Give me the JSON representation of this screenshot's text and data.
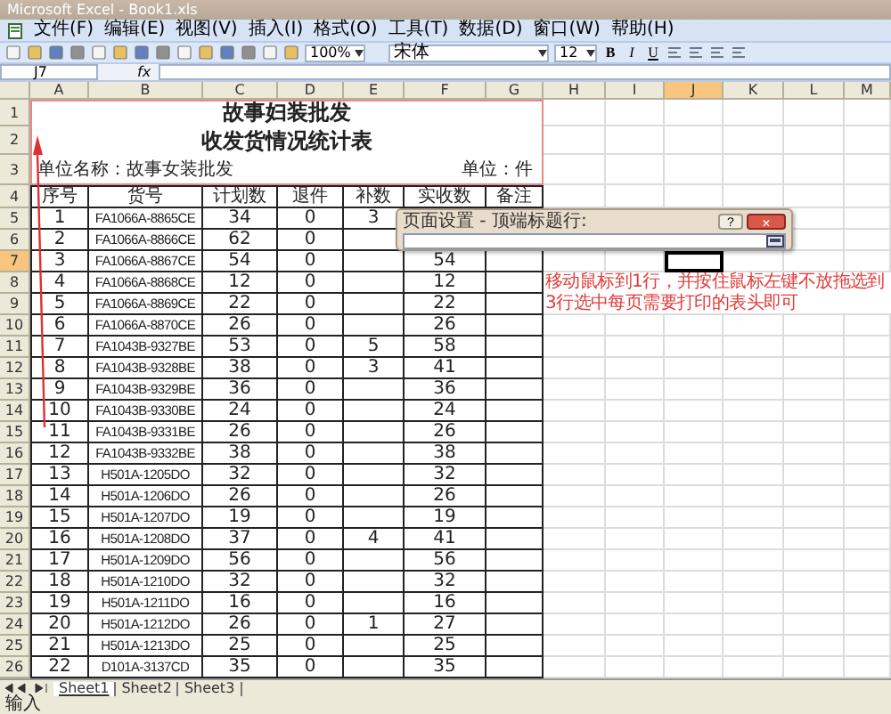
{
  "window": {
    "title": "Microsoft Excel - Book1.xls"
  },
  "menu": [
    "文件(F)",
    "编辑(E)",
    "视图(V)",
    "插入(I)",
    "格式(O)",
    "工具(T)",
    "数据(D)",
    "窗口(W)",
    "帮助(H)"
  ],
  "toolbar": {
    "zoom": "100%",
    "font": "宋体",
    "size": "12",
    "format_buttons": [
      "B",
      "I",
      "U"
    ]
  },
  "formula_bar": {
    "name_box": "J7",
    "fx": "fx"
  },
  "columns": [
    {
      "label": "A",
      "selected": false
    },
    {
      "label": "B",
      "selected": false
    },
    {
      "label": "C",
      "selected": false
    },
    {
      "label": "D",
      "selected": false
    },
    {
      "label": "E",
      "selected": false
    },
    {
      "label": "F",
      "selected": false
    },
    {
      "label": "G",
      "selected": false
    },
    {
      "label": "H",
      "selected": false
    },
    {
      "label": "I",
      "selected": false
    },
    {
      "label": "J",
      "selected": true
    },
    {
      "label": "K",
      "selected": false
    },
    {
      "label": "L",
      "selected": false
    },
    {
      "label": "M",
      "selected": false
    }
  ],
  "rows": [
    {
      "number": "1",
      "selected": false,
      "kind": "title",
      "text": "故事妇装批发"
    },
    {
      "number": "2",
      "selected": false,
      "kind": "subtitle",
      "text": "收发货情况统计表"
    },
    {
      "number": "3",
      "selected": false,
      "kind": "info",
      "left": "单位名称：故事女装批发",
      "right": "单位：件"
    },
    {
      "number": "4",
      "selected": false,
      "kind": "header",
      "cells": [
        "序号",
        "货号",
        "计划数",
        "退件",
        "补数",
        "实收数",
        "备注"
      ]
    },
    {
      "number": "5",
      "selected": false,
      "kind": "data",
      "no": "1",
      "code": "FA1066A-8865CE",
      "plan": "34",
      "returned": "0",
      "extra": "3"
    },
    {
      "number": "6",
      "selected": false,
      "kind": "data",
      "no": "2",
      "code": "FA1066A-8866CE",
      "plan": "62",
      "returned": "0"
    },
    {
      "number": "7",
      "selected": true,
      "kind": "data",
      "no": "3",
      "code": "FA1066A-8867CE",
      "plan": "54",
      "returned": "0",
      "actual": "54"
    },
    {
      "number": "8",
      "selected": false,
      "kind": "data",
      "no": "4",
      "code": "FA1066A-8868CE",
      "plan": "12",
      "returned": "0",
      "actual": "12"
    },
    {
      "number": "9",
      "selected": false,
      "kind": "data",
      "no": "5",
      "code": "FA1066A-8869CE",
      "plan": "22",
      "returned": "0",
      "actual": "22"
    },
    {
      "number": "10",
      "selected": false,
      "kind": "data",
      "no": "6",
      "code": "FA1066A-8870CE",
      "plan": "26",
      "returned": "0",
      "actual": "26"
    },
    {
      "number": "11",
      "selected": false,
      "kind": "data",
      "no": "7",
      "code": "FA1043B-9327BE",
      "plan": "53",
      "returned": "0",
      "extra": "5",
      "actual": "58"
    },
    {
      "number": "12",
      "selected": false,
      "kind": "data",
      "no": "8",
      "code": "FA1043B-9328BE",
      "plan": "38",
      "returned": "0",
      "extra": "3",
      "actual": "41"
    },
    {
      "number": "13",
      "selected": false,
      "kind": "data",
      "no": "9",
      "code": "FA1043B-9329BE",
      "plan": "36",
      "returned": "0",
      "actual": "36"
    },
    {
      "number": "14",
      "selected": false,
      "kind": "data",
      "no": "10",
      "code": "FA1043B-9330BE",
      "plan": "24",
      "returned": "0",
      "actual": "24"
    },
    {
      "number": "15",
      "selected": false,
      "kind": "data",
      "no": "11",
      "code": "FA1043B-9331BE",
      "plan": "26",
      "returned": "0",
      "actual": "26"
    },
    {
      "number": "16",
      "selected": false,
      "kind": "data",
      "no": "12",
      "code": "FA1043B-9332BE",
      "plan": "38",
      "returned": "0",
      "actual": "38"
    },
    {
      "number": "17",
      "selected": false,
      "kind": "data",
      "no": "13",
      "code": "H501A-1205DO",
      "plan": "32",
      "returned": "0",
      "actual": "32"
    },
    {
      "number": "18",
      "selected": false,
      "kind": "data",
      "no": "14",
      "code": "H501A-1206DO",
      "plan": "26",
      "returned": "0",
      "actual": "26"
    },
    {
      "number": "19",
      "selected": false,
      "kind": "data",
      "no": "15",
      "code": "H501A-1207DO",
      "plan": "19",
      "returned": "0",
      "actual": "19"
    },
    {
      "number": "20",
      "selected": false,
      "kind": "data",
      "no": "16",
      "code": "H501A-1208DO",
      "plan": "37",
      "returned": "0",
      "extra": "4",
      "actual": "41"
    },
    {
      "number": "21",
      "selected": false,
      "kind": "data",
      "no": "17",
      "code": "H501A-1209DO",
      "plan": "56",
      "returned": "0",
      "actual": "56"
    },
    {
      "number": "22",
      "selected": false,
      "kind": "data",
      "no": "18",
      "code": "H501A-1210DO",
      "plan": "32",
      "returned": "0",
      "actual": "32"
    },
    {
      "number": "23",
      "selected": false,
      "kind": "data",
      "no": "19",
      "code": "H501A-1211DO",
      "plan": "16",
      "returned": "0",
      "actual": "16"
    },
    {
      "number": "24",
      "selected": false,
      "kind": "data",
      "no": "20",
      "code": "H501A-1212DO",
      "plan": "26",
      "returned": "0",
      "extra": "1",
      "actual": "27"
    },
    {
      "number": "25",
      "selected": false,
      "kind": "data",
      "no": "21",
      "code": "H501A-1213DO",
      "plan": "25",
      "returned": "0",
      "actual": "25"
    },
    {
      "number": "26",
      "selected": false,
      "kind": "data",
      "no": "22",
      "code": "D101A-3137CD",
      "plan": "35",
      "returned": "0",
      "actual": "35"
    }
  ],
  "dialog": {
    "title": "页面设置 - 顶端标题行:",
    "help": "?",
    "close": "×"
  },
  "annotation": [
    "移动鼠标到1行，并按住鼠标左键不放拖选到",
    "3行选中每页需要打印的表头即可"
  ],
  "sheet_tabs": [
    {
      "label": "Sheet1",
      "selected": true
    },
    {
      "label": "Sheet2",
      "selected": false
    },
    {
      "label": "Sheet3",
      "selected": false
    }
  ],
  "status_bar": "输入"
}
